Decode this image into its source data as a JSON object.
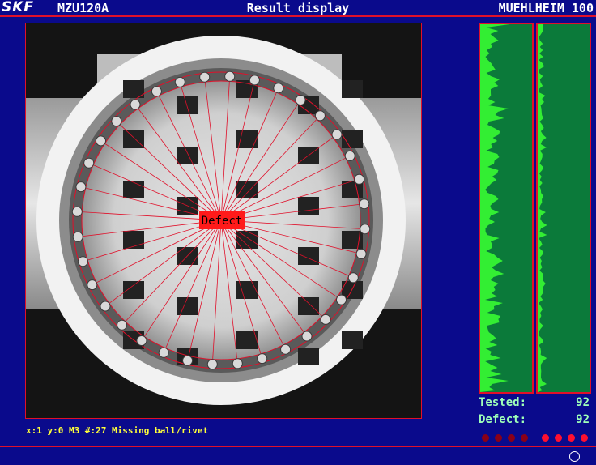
{
  "header": {
    "logo": "SKF",
    "machine": "MZU120A",
    "title": "Result display",
    "location": "MUEHLHEIM 100"
  },
  "inspection": {
    "overlay_label": "Defect",
    "status_line": "x:1 y:0 M3 #:27 Missing ball/rivet",
    "ray_count": 36
  },
  "counters": {
    "tested_label": "Tested:",
    "tested_value": "92",
    "defect_label": "Defect:",
    "defect_value": "92"
  },
  "leds": {
    "states": [
      "off",
      "off",
      "off",
      "off",
      "on",
      "on",
      "on",
      "on"
    ],
    "off_color": "#8a0018",
    "on_color": "#ff1030"
  },
  "colors": {
    "background": "#0a0a8c",
    "accent": "#e0102a",
    "histogram_bg": "#0b7a3a",
    "histogram_fg": "#33ee33",
    "status_text": "#ffff3a",
    "counter_text": "#9fffb8"
  },
  "icons": {
    "bottom_right": "circle-icon"
  }
}
